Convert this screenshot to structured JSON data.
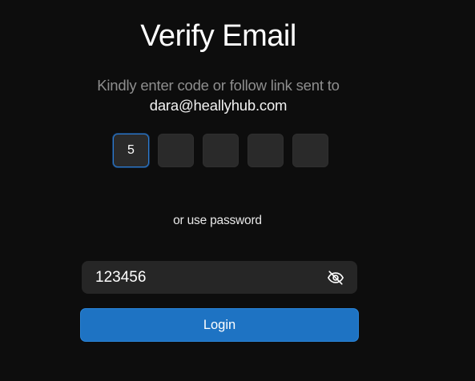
{
  "header": {
    "title": "Verify Email",
    "instruction": "Kindly enter code or follow link sent to",
    "email": "dara@heallyhub.com"
  },
  "code": {
    "digits": [
      "5",
      "",
      "",
      "",
      ""
    ],
    "active_index": 0
  },
  "alternate": {
    "text": "or use password"
  },
  "password": {
    "value": "123456",
    "visibility_icon": "eye-off-icon"
  },
  "actions": {
    "login_label": "Login"
  },
  "colors": {
    "background": "#0d0d0d",
    "accent": "#1e73c3",
    "field": "#262626"
  }
}
